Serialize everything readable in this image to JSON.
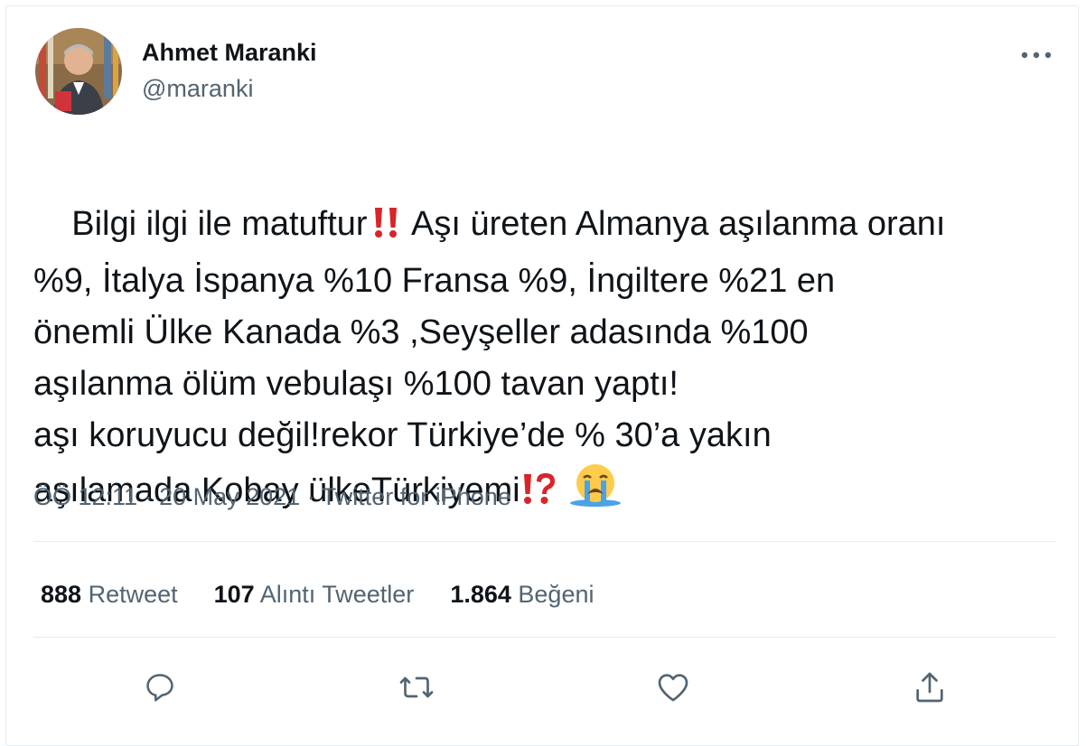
{
  "author": {
    "name": "Ahmet Maranki",
    "handle": "@maranki"
  },
  "tweet": {
    "segments": [
      {
        "type": "text",
        "value": "Bilgi ilgi ile matuftur"
      },
      {
        "type": "emoji",
        "name": "double-exclamation-icon"
      },
      {
        "type": "text",
        "value": " Aşı üreten Almanya aşılanma oranı\n%9, İtalya İspanya %10 Fransa %9, İngiltere %21 en\nönemli Ülke Kanada %3 ,Seyşeller adasında %100\naşılanma ölüm vebulaşı %100 tavan yaptı!\naşı koruyucu değil!rekor Türkiye’de % 30’a yakın\naşılamada Kobay ülkeTürkiyemi"
      },
      {
        "type": "emoji",
        "name": "exclamation-question-icon"
      },
      {
        "type": "text",
        "value": " "
      },
      {
        "type": "emoji",
        "name": "loudly-crying-face-icon"
      }
    ]
  },
  "meta": {
    "time": "ÖÖ 12:11",
    "separator1": " · ",
    "date": "20 May 2021",
    "separator2": " · ",
    "source": "Twitter for iPhone"
  },
  "stats": {
    "retweets": {
      "count": "888",
      "label": "Retweet"
    },
    "quotes": {
      "count": "107",
      "label": "Alıntı Tweetler"
    },
    "likes": {
      "count": "1.864",
      "label": "Beğeni"
    }
  },
  "actions": [
    {
      "name": "reply-icon"
    },
    {
      "name": "retweet-icon"
    },
    {
      "name": "like-icon"
    },
    {
      "name": "share-icon"
    }
  ],
  "colors": {
    "text": "#0f1419",
    "secondary": "#536471",
    "divider": "#e6ecf0",
    "emoji_red": "#d8242a",
    "emoji_yellow": "#ffcb4c"
  }
}
